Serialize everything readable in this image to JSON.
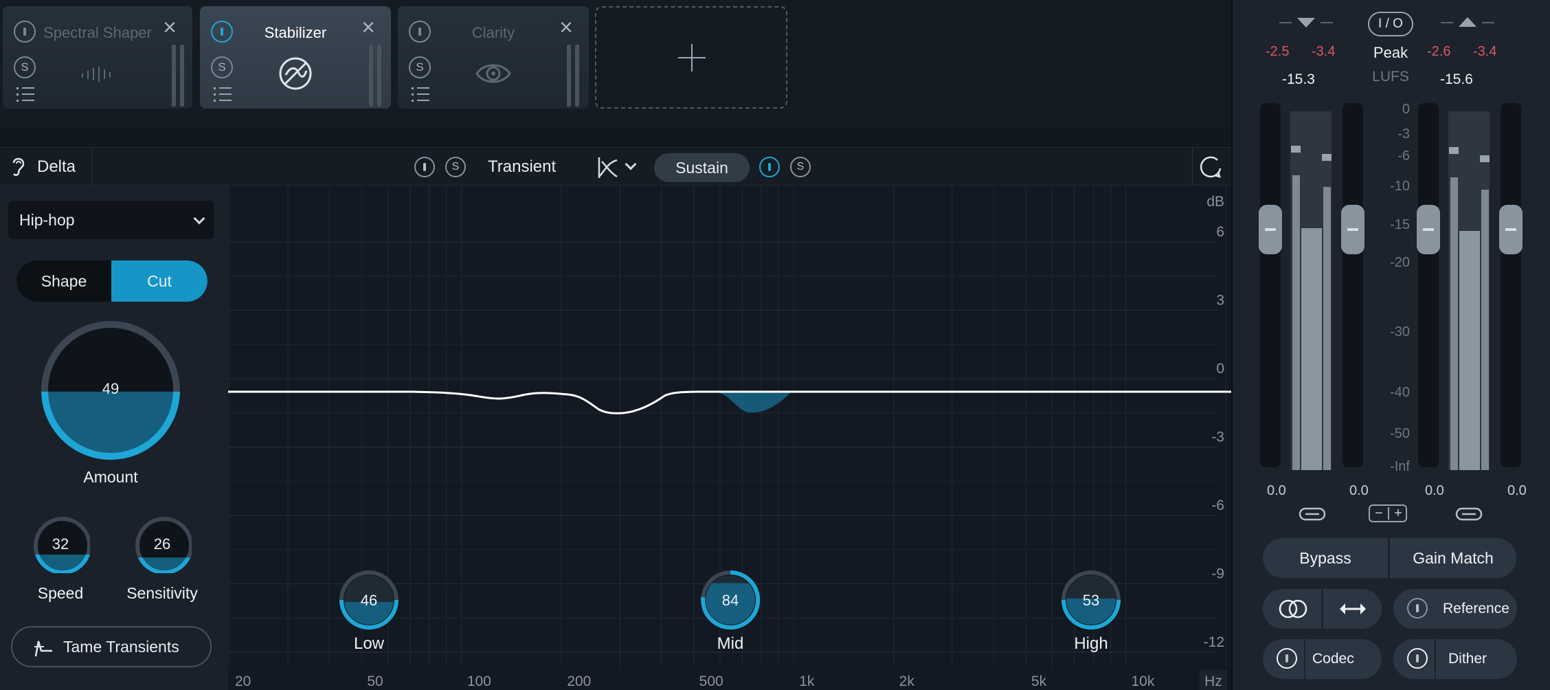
{
  "modules": [
    {
      "title": "Spectral Shaper",
      "solo": "S",
      "close": "×"
    },
    {
      "title": "Stabilizer",
      "solo": "S",
      "close": "×"
    },
    {
      "title": "Clarity",
      "solo": "S",
      "close": "×"
    }
  ],
  "toolbar": {
    "delta_label": "Delta",
    "transient_label": "Transient",
    "sustain_label": "Sustain",
    "solo_label": "S"
  },
  "left": {
    "preset": "Hip-hop",
    "mode": {
      "shape": "Shape",
      "cut": "Cut",
      "selected": "Cut"
    },
    "amount": {
      "value": "49",
      "label": "Amount",
      "fraction": 0.49
    },
    "speed": {
      "value": "32",
      "label": "Speed",
      "fraction": 0.32
    },
    "sensitivity": {
      "value": "26",
      "label": "Sensitivity",
      "fraction": 0.26
    },
    "tame_label": "Tame Transients"
  },
  "graph": {
    "db_unit": "dB",
    "db_ticks": [
      "6",
      "3",
      "0",
      "-3",
      "-6",
      "-9",
      "-12"
    ],
    "hz_unit": "Hz",
    "hz_ticks": [
      "20",
      "50",
      "100",
      "200",
      "500",
      "1k",
      "2k",
      "5k",
      "10k"
    ],
    "bands": [
      {
        "value": "46",
        "label": "Low",
        "fraction": 0.46
      },
      {
        "value": "84",
        "label": "Mid",
        "fraction": 0.84
      },
      {
        "value": "53",
        "label": "High",
        "fraction": 0.53
      }
    ]
  },
  "io": {
    "io_label": "I / O",
    "input_peak": [
      "-2.5",
      "-3.4"
    ],
    "output_peak": [
      "-2.6",
      "-3.4"
    ],
    "input_lufs": "-15.3",
    "output_lufs": "-15.6",
    "peak_label": "Peak",
    "lufs_label": "LUFS",
    "scale": [
      "0",
      "-3",
      "-6",
      "-10",
      "-15",
      "-20",
      "-30",
      "-40",
      "-50",
      "-Inf"
    ],
    "gains": [
      "0.0",
      "0.0",
      "0.0",
      "0.0"
    ],
    "minus": "−",
    "plus": "+"
  },
  "footer": {
    "bypass": "Bypass",
    "gain_match": "Gain Match",
    "reference": "Reference",
    "codec": "Codec",
    "dither": "Dither"
  },
  "colors": {
    "accent": "#1ea7d6",
    "peak_red": "#e05560"
  }
}
